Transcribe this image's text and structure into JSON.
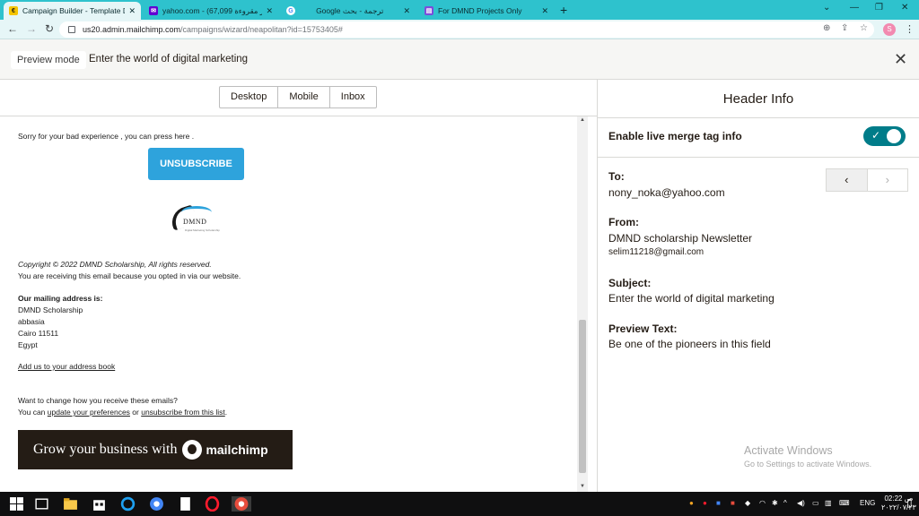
{
  "browser": {
    "tabs": [
      {
        "label": "Campaign Builder - Template De",
        "active": true
      },
      {
        "label": "yahoo.com - (غير مقروءة 67,099)",
        "active": false
      },
      {
        "label": "Google ترجمة - بحث",
        "active": false
      },
      {
        "label": "For DMND Projects Only",
        "active": false
      }
    ],
    "new_tab": "+",
    "url_host": "us20.admin.mailchimp.com",
    "url_path": "/campaigns/wizard/neapolitan?id=15753405#",
    "profile_initial": "S"
  },
  "preview": {
    "mode_label": "Preview mode",
    "title": "Enter the world of digital marketing",
    "close_symbol": "✕"
  },
  "device_tabs": [
    "Desktop",
    "Mobile",
    "Inbox"
  ],
  "email": {
    "sorry_text": "Sorry for your bad experience , you can press here .",
    "unsubscribe_button": "UNSUBSCRIBE",
    "logo": {
      "word": "DMND",
      "tagline": "Digital Marketing Scholarship"
    },
    "copyright": "Copyright © 2022 DMND Scholarship, All rights reserved.",
    "receiving": "You are receiving this email because you opted in via our website.",
    "mailing_heading": "Our mailing address is:",
    "address_lines": [
      "DMND Scholarship",
      "abbasia",
      "Cairo 11511",
      "Egypt"
    ],
    "add_to_book": "Add us to your address book",
    "change_q": "Want to change how you receive these emails?",
    "change_prefix": "You can ",
    "update_prefs": "update your preferences",
    "or_text": " or ",
    "unsub_list": "unsubscribe from this list",
    "period": ".",
    "banner_text": "Grow your business with",
    "banner_brand": "mailchimp"
  },
  "header_info": {
    "title": "Header Info",
    "merge_tag_label": "Enable live merge tag info",
    "merge_tag_enabled": true,
    "to_label": "To:",
    "to_value": "nony_noka@yahoo.com",
    "from_label": "From:",
    "from_name": "DMND scholarship Newsletter",
    "from_email": "selim11218@gmail.com",
    "subject_label": "Subject:",
    "subject_value": "Enter the world of digital marketing",
    "preview_label": "Preview Text:",
    "preview_value": "Be one of the pioneers in this field",
    "pager_prev": "‹",
    "pager_next": "›"
  },
  "watermark": {
    "line1": "Activate Windows",
    "line2": "Go to Settings to activate Windows."
  },
  "taskbar": {
    "language": "ENG",
    "time": "02:22 ص",
    "date": "٢٠٢٢/٠٧/٢٣"
  },
  "colors": {
    "tabbar": "#2ec2cd",
    "mailchimp_teal": "#007c89",
    "unsubscribe_blue": "#2ea3dc",
    "banner_dark": "#241c15"
  }
}
